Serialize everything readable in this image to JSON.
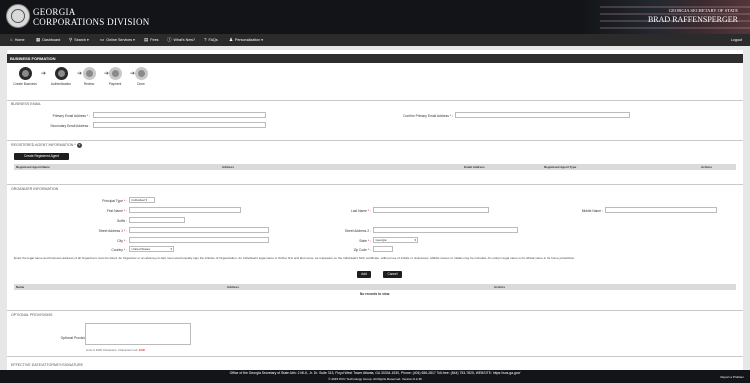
{
  "header": {
    "brand_line1": "GEORGIA",
    "brand_line2": "CORPORATIONS DIVISION",
    "sos_line1": "GEORGIA SECRETARY OF STATE",
    "sos_line2": "BRAD RAFFENSPERGER"
  },
  "nav": {
    "home": "Home",
    "dashboard": "Dashboard",
    "search": "Search ▾",
    "online_services": "Online Services ▾",
    "fees": "Fees",
    "whats_new": "What's New?",
    "faqs": "FAQs",
    "personalization": "Personalization ▾",
    "logout": "Logout"
  },
  "page_title": "BUSINESS FORMATION",
  "steps": [
    {
      "label": "Create Business"
    },
    {
      "label": "Authentication"
    },
    {
      "label": "Review"
    },
    {
      "label": "Payment"
    },
    {
      "label": "Done"
    }
  ],
  "business_email": {
    "section": "BUSINESS EMAIL",
    "primary_label": "Primary Email Address",
    "confirm_label": "Confirm Primary Email Address",
    "secondary_label": "Secondary Email Address"
  },
  "registered_agent": {
    "section": "REGISTERED AGENT INFORMATION",
    "create_button": "Create Registered Agent",
    "columns": [
      "Registered Agent Name",
      "Address",
      "Email Address",
      "Registered Agent Type",
      "Actions"
    ]
  },
  "organizer": {
    "section": "ORGANIZER INFORMATION",
    "principal_type_label": "Principal Type",
    "principal_type_value": "Individual",
    "first_name_label": "First Name",
    "middle_name_label": "Middle Name",
    "last_name_label": "Last Name",
    "suffix_label": "Suffix",
    "street1_label": "Street Address 1",
    "street2_label": "Street Address 2",
    "city_label": "City",
    "state_label": "State",
    "state_value": "Georgia",
    "zip_label": "Zip Code",
    "country_label": "Country",
    "country_value": "United States",
    "note": "Enter the legal name and business address of all Organizers must be listed. An Organizer or an attorney-in-fact must electronically sign the Articles of Organization. An individual's legal name is his/her first and last name, as it appears on the individual's birth certificate, without use of initials or nicknames. Middle names or initials may be included. An entity's legal name is its official name in its home jurisdiction.",
    "add_button": "Add",
    "cancel_button": "Cancel",
    "columns": [
      "Name",
      "Address",
      "Actions"
    ],
    "empty_text": "No records to view."
  },
  "optional": {
    "section": "OPTIONAL PROVISIONS",
    "label": "Optional Provisions",
    "hint": "Limit of 4000 Characters. Characters Left:",
    "count": "4000"
  },
  "next_section": "EFFECTIVE DATE/ATTORNEY/SIGNATURE",
  "footer": {
    "line1": "Office of the Georgia Secretary of State Attn: 2 MLK, Jr. Dr. Suite 313, Floyd West Tower Atlanta, GA 30334-1530, Phone: (404) 656-2817 Toll-free: (844) 753-7825, WEBSITE: https://sos.ga.gov/",
    "line2": "© 2015 PCC Technology Group. All Rights Reserved. Version 6.2.39",
    "report": "Report a Problem"
  }
}
